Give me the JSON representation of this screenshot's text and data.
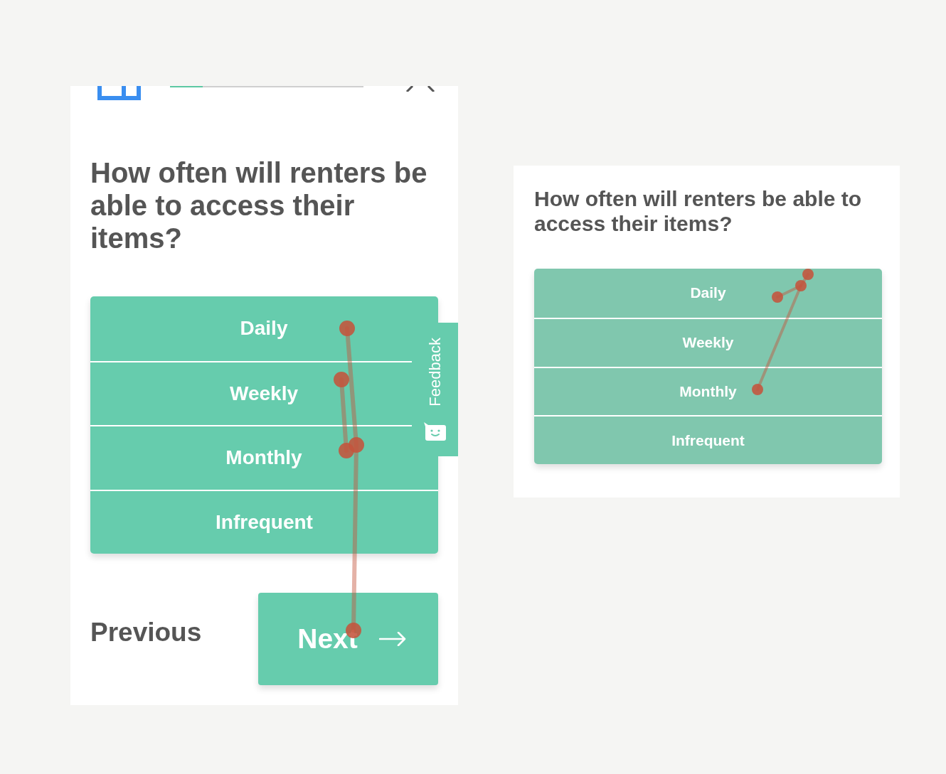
{
  "panels": [
    {
      "kind": "mobile",
      "header": {
        "progress": {
          "level": 0.17
        }
      },
      "question": "How often will renters be able to access their items?",
      "options": [
        {
          "label": "Daily",
          "selected": false
        },
        {
          "label": "Weekly",
          "selected": false
        },
        {
          "label": "Monthly",
          "selected": false
        },
        {
          "label": "Infrequent",
          "selected": false
        }
      ],
      "feedback_tab": {
        "label": "Feedback"
      },
      "nav": {
        "previous": "Previous",
        "next": "Next"
      },
      "trail": true
    },
    {
      "kind": "desktop",
      "question": "How often will renters be able to access their items?",
      "options": [
        {
          "label": "Daily",
          "selected": false
        },
        {
          "label": "Weekly",
          "selected": false
        },
        {
          "label": "Monthly",
          "selected": false
        },
        {
          "label": "Infrequent",
          "selected": false
        }
      ],
      "trail": true
    }
  ]
}
